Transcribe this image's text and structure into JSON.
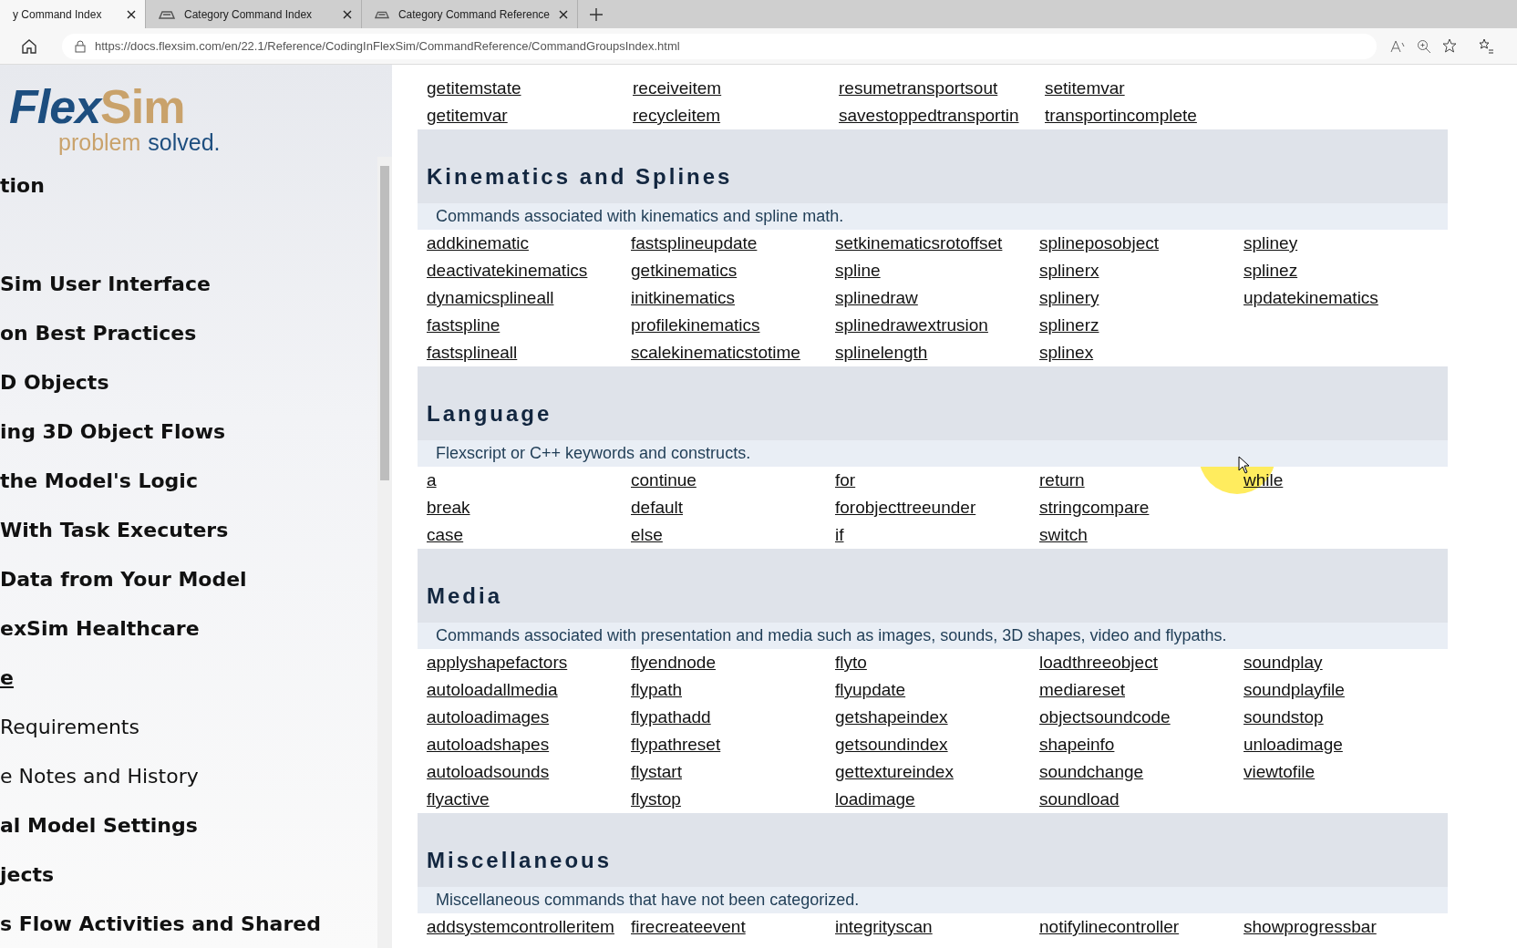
{
  "browser": {
    "tabs": [
      {
        "title": "y Command Index",
        "selected": true
      },
      {
        "title": "Category Command Index",
        "selected": false
      },
      {
        "title": "Category Command Reference",
        "selected": false
      }
    ],
    "url": "https://docs.flexsim.com/en/22.1/Reference/CodingInFlexSim/CommandReference/CommandGroupsIndex.html"
  },
  "logo": {
    "word_1": "Flex",
    "word_2": "Sim",
    "tagline_1": "problem",
    "tagline_2": "solved."
  },
  "sidebar": {
    "items": [
      {
        "label": "tion",
        "kind": "section",
        "selected": false
      },
      {
        "label": "Sim User Interface",
        "kind": "section",
        "selected": false
      },
      {
        "label": "on Best Practices",
        "kind": "section",
        "selected": false
      },
      {
        "label": "D Objects",
        "kind": "section",
        "selected": false
      },
      {
        "label": "ing 3D Object Flows",
        "kind": "section",
        "selected": false
      },
      {
        "label": "the Model's Logic",
        "kind": "section",
        "selected": false
      },
      {
        "label": "With Task Executers",
        "kind": "section",
        "selected": false
      },
      {
        "label": "Data from Your Model",
        "kind": "section",
        "selected": false
      },
      {
        "label": "exSim Healthcare",
        "kind": "section",
        "selected": false
      },
      {
        "label": "e",
        "kind": "section",
        "selected": true
      },
      {
        "label": "Requirements",
        "kind": "page",
        "selected": false
      },
      {
        "label": "e Notes and History",
        "kind": "page",
        "selected": false
      },
      {
        "label": "al Model Settings",
        "kind": "section",
        "selected": false
      },
      {
        "label": "jects",
        "kind": "section",
        "selected": false
      },
      {
        "label": "s Flow Activities and Shared",
        "kind": "section",
        "selected": false
      }
    ]
  },
  "sections": [
    {
      "columns": [
        [
          "getitemstate",
          "getitemvar"
        ],
        [
          "receiveitem",
          "recycleitem"
        ],
        [
          "resumetransportsout",
          "savestoppedtransportin"
        ],
        [
          "setitemvar",
          "transportincomplete"
        ]
      ]
    },
    {
      "title": "Kinematics and Splines",
      "description": "Commands associated with kinematics and spline math.",
      "columns": [
        [
          "addkinematic",
          "deactivatekinematics",
          "dynamicsplineall",
          "fastspline",
          "fastsplineall"
        ],
        [
          "fastsplineupdate",
          "getkinematics",
          "initkinematics",
          "profilekinematics",
          "scalekinematicstotime"
        ],
        [
          "setkinematicsrotoffset",
          "spline",
          "splinedraw",
          "splinedrawextrusion",
          "splinelength"
        ],
        [
          "splineposobject",
          "splinerx",
          "splinery",
          "splinerz",
          "splinex"
        ],
        [
          "spliney",
          "splinez",
          "updatekinematics"
        ]
      ]
    },
    {
      "title": "Language",
      "description": "Flexscript or C++ keywords and constructs.",
      "columns": [
        [
          "a",
          "break",
          "case"
        ],
        [
          "continue",
          "default",
          "else"
        ],
        [
          "for",
          "forobjecttreeunder",
          "if"
        ],
        [
          "return",
          "stringcompare",
          "switch"
        ],
        [
          "while"
        ]
      ]
    },
    {
      "title": "Media",
      "description": "Commands associated with presentation and media such as images, sounds, 3D shapes, video and flypaths.",
      "columns": [
        [
          "applyshapefactors",
          "autoloadallmedia",
          "autoloadimages",
          "autoloadshapes",
          "autoloadsounds",
          "flyactive"
        ],
        [
          "flyendnode",
          "flypath",
          "flypathadd",
          "flypathreset",
          "flystart",
          "flystop"
        ],
        [
          "flyto",
          "flyupdate",
          "getshapeindex",
          "getsoundindex",
          "gettextureindex",
          "loadimage"
        ],
        [
          "loadthreeobject",
          "mediareset",
          "objectsoundcode",
          "shapeinfo",
          "soundchange",
          "soundload"
        ],
        [
          "soundplay",
          "soundplayfile",
          "soundstop",
          "unloadimage",
          "viewtofile"
        ]
      ]
    },
    {
      "title": "Miscellaneous",
      "description": "Miscellaneous commands that have not been categorized.",
      "columns": [
        [
          "addsystemcontrolleritem"
        ],
        [
          "firecreateevent"
        ],
        [
          "integrityscan"
        ],
        [
          "notifylinecontroller"
        ],
        [
          "showprogressbar"
        ]
      ]
    }
  ]
}
